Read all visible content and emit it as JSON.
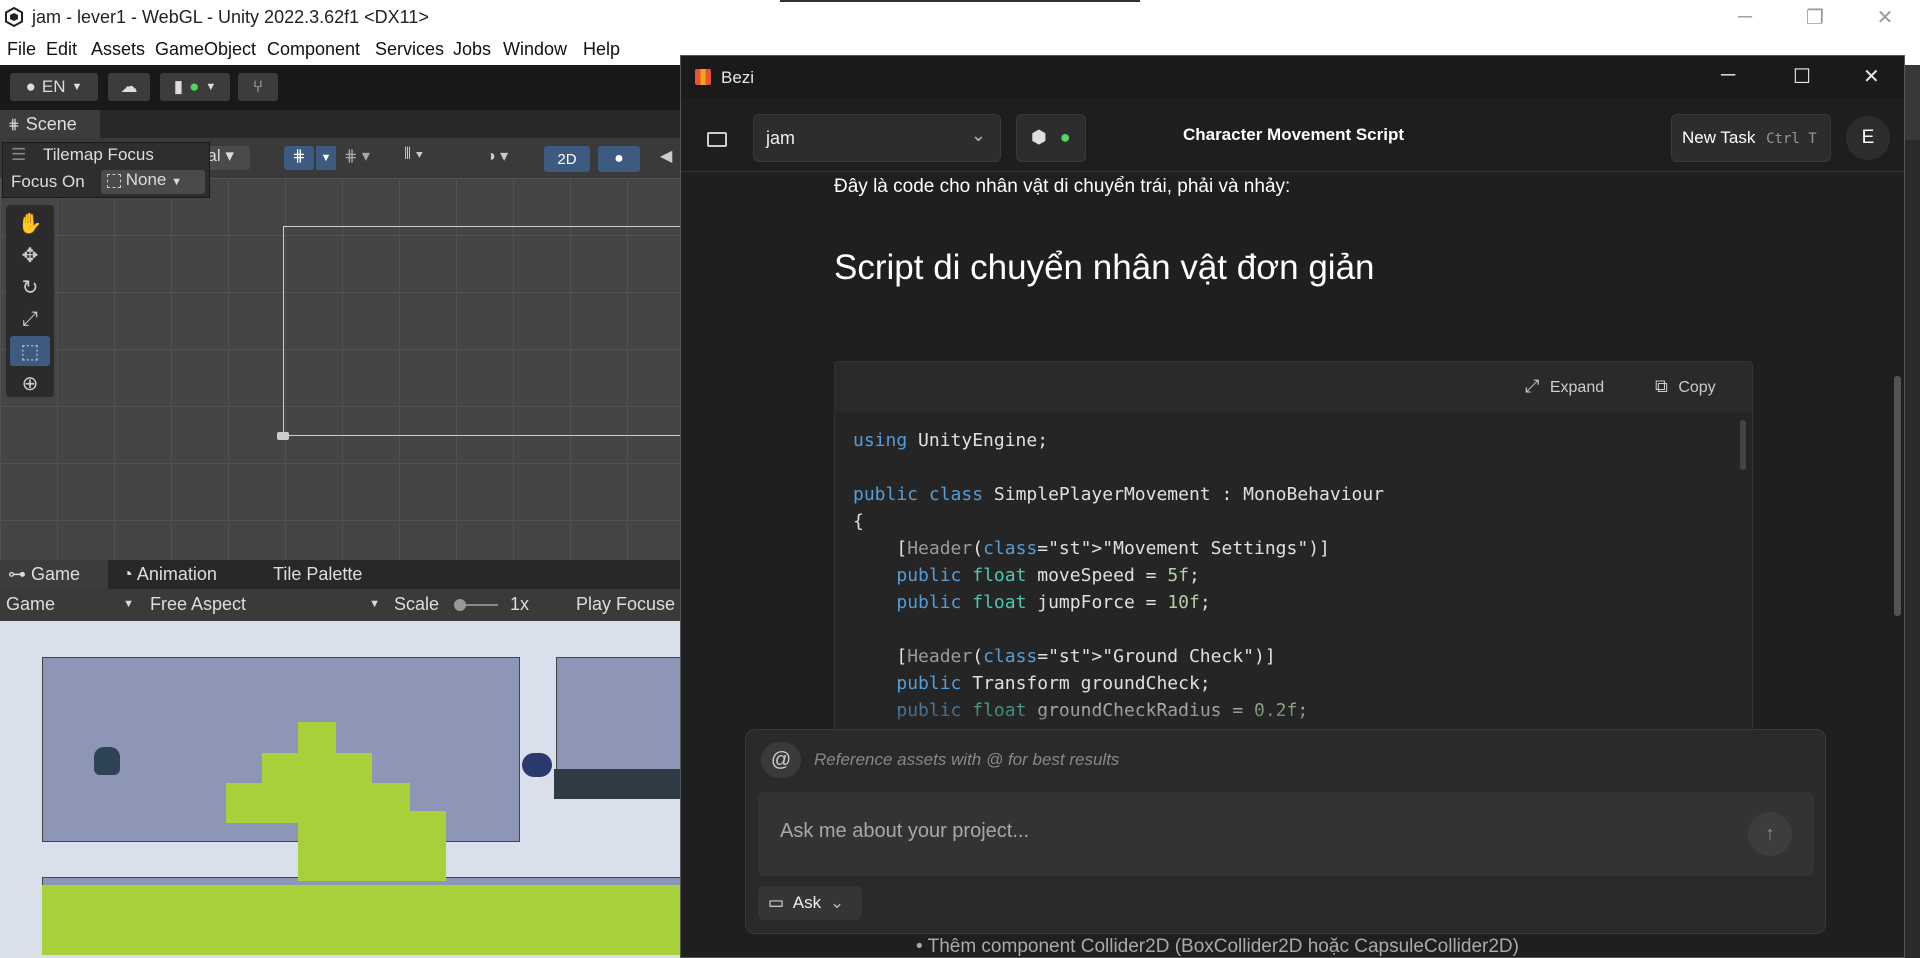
{
  "unity": {
    "window_title": "jam - lever1 - WebGL - Unity 2022.3.62f1 <DX11>",
    "menu": [
      "File",
      "Edit",
      "Assets",
      "GameObject",
      "Component",
      "Services",
      "Jobs",
      "Window",
      "Help"
    ],
    "toolbar": {
      "account": "EN"
    },
    "scene_tab": "Scene",
    "scene_toolbar": {
      "pivot_local": "Local",
      "mode_2d": "2D"
    },
    "tilemap_focus": {
      "title": "Tilemap Focus",
      "label": "Focus On",
      "value": "None"
    },
    "game_tabs": [
      "Game",
      "Animation",
      "Tile Palette"
    ],
    "game_toolbar": {
      "display": "Game",
      "aspect": "Free Aspect",
      "scale_label": "Scale",
      "scale_value": "1x",
      "play_focused": "Play Focuse"
    }
  },
  "bezi": {
    "app_title": "Bezi",
    "project": "jam",
    "chat_title": "Character Movement Script",
    "new_task_label": "New Task",
    "new_task_shortcut": "Ctrl T",
    "avatar_initial": "E",
    "intro_text": "Đây là code cho nhân vật di chuyển trái, phải và nhảy:",
    "heading": "Script di chuyển nhân vật đơn giản",
    "code_actions": {
      "expand": "Expand",
      "copy": "Copy"
    },
    "code_lines": [
      "using UnityEngine;",
      "",
      "public class SimplePlayerMovement : MonoBehaviour",
      "{",
      "    [Header(\"Movement Settings\")]",
      "    public float moveSpeed = 5f;",
      "    public float jumpForce = 10f;",
      "",
      "    [Header(\"Ground Check\")]",
      "    public Transform groundCheck;",
      "    public float groundCheckRadius = 0.2f;"
    ],
    "chat": {
      "reference_hint": "Reference assets with @ for best results",
      "placeholder": "Ask me about your project...",
      "mode": "Ask"
    },
    "footer_text": "• Thêm component Collider2D (BoxCollider2D hoặc CapsuleCollider2D)"
  },
  "colors": {
    "keyword": "#569cd6",
    "type": "#4ec9b0",
    "string": "#ce9178",
    "number": "#b5cea8"
  }
}
